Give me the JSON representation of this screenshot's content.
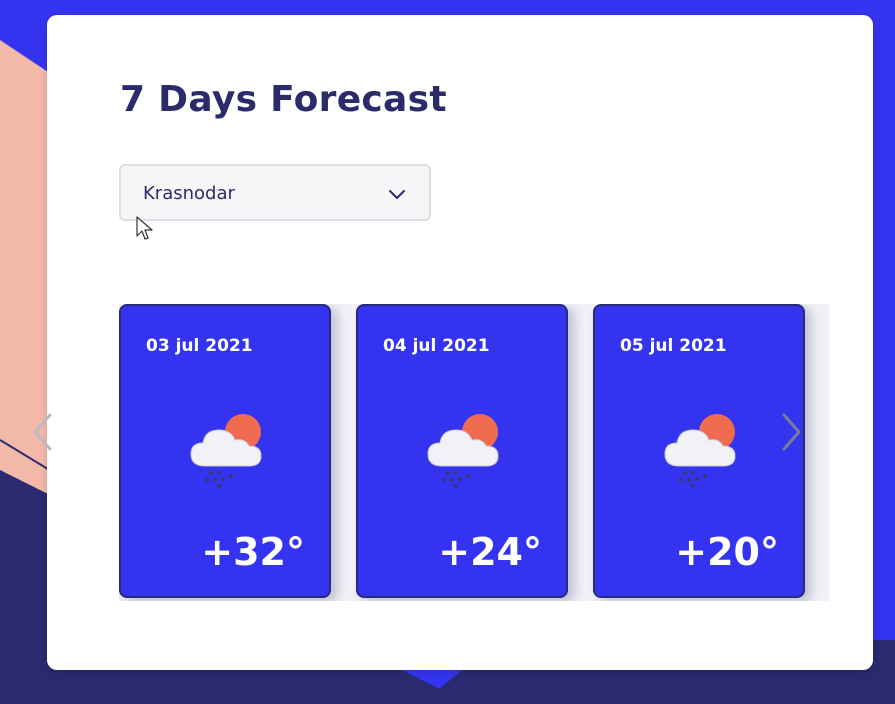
{
  "page": {
    "title": "7 Days Forecast"
  },
  "city_select": {
    "selected": "Krasnodar"
  },
  "forecast": {
    "days": [
      {
        "date": "03 jul 2021",
        "icon": "cloud-sun-rain-icon",
        "temp": "+32°"
      },
      {
        "date": "04 jul 2021",
        "icon": "cloud-sun-rain-icon",
        "temp": "+24°"
      },
      {
        "date": "05 jul 2021",
        "icon": "cloud-sun-rain-icon",
        "temp": "+20°"
      }
    ],
    "icons": {
      "prev": "chevron-left-icon",
      "next": "chevron-right-icon",
      "select": "chevron-down-icon"
    }
  },
  "colors": {
    "background_blue": "#3434F0",
    "background_peach": "#F2B9A8",
    "background_navy": "#2A2A70",
    "title": "#2B2A6B",
    "card_bg": "#3434F0",
    "card_text": "#FFFFFF",
    "sun": "#F06B4F",
    "cloud": "#F2F2F6"
  }
}
